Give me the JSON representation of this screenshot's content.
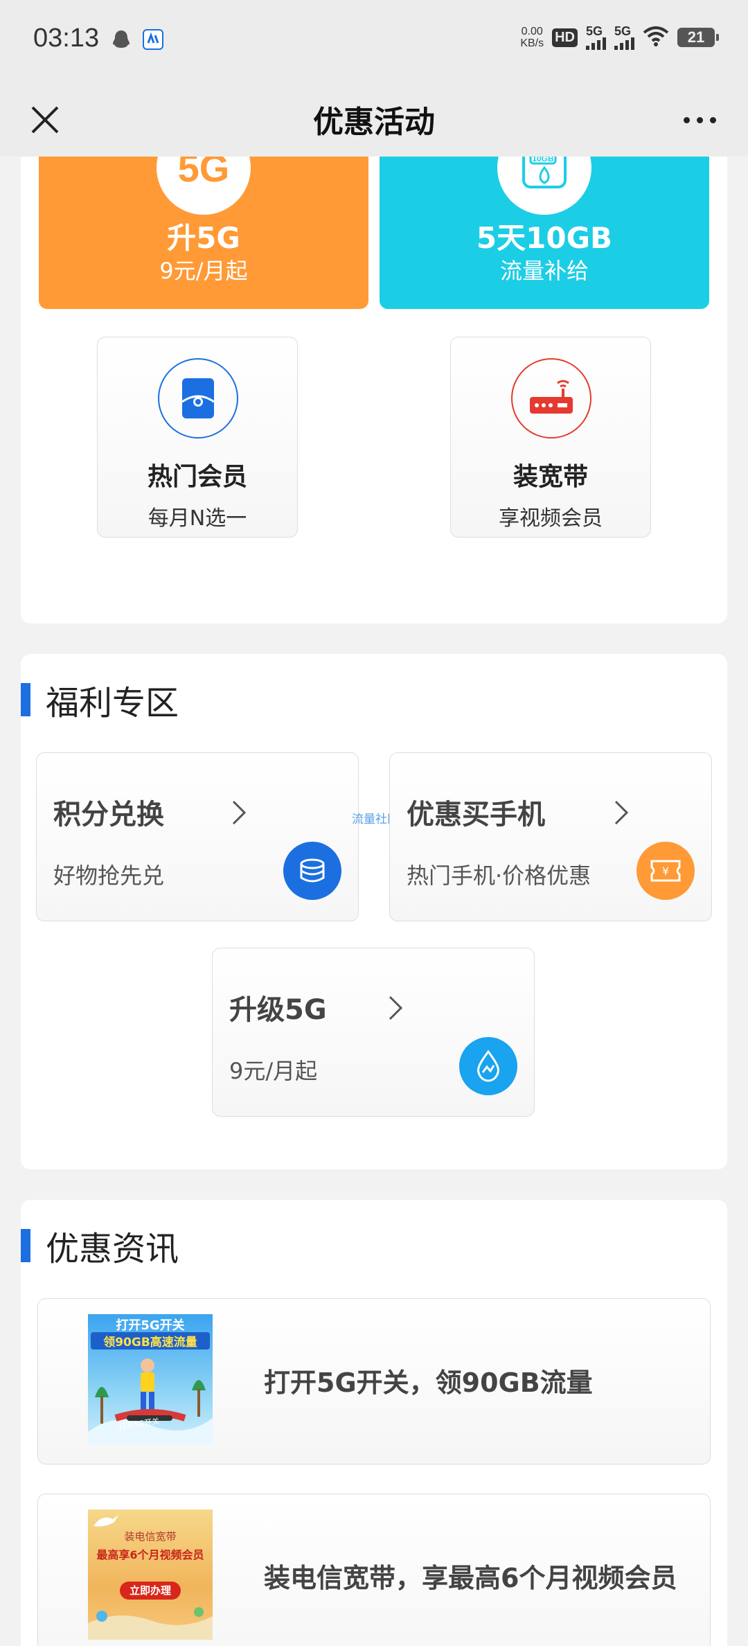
{
  "status_bar": {
    "time": "03:13",
    "net_speed_value": "0.00",
    "net_speed_unit": "KB/s",
    "hd_label": "HD",
    "sim1_label": "5G",
    "sim2_label": "5G",
    "battery": "21"
  },
  "nav": {
    "title": "优惠活动"
  },
  "top_section": {
    "tiles": [
      {
        "icon_text": "5G",
        "title": "升5G",
        "subtitle": "9元/月起",
        "color": "#ff9a36"
      },
      {
        "icon_text": "10GB",
        "title": "5天10GB",
        "subtitle": "流量补给",
        "color": "#1ccde6"
      }
    ],
    "small_tiles": [
      {
        "title": "热门会员",
        "subtitle": "每月N选一"
      },
      {
        "title": "装宽带",
        "subtitle": "享视频会员"
      }
    ]
  },
  "welfare": {
    "title": "福利专区",
    "items": [
      {
        "title": "积分兑换",
        "subtitle": "好物抢先兑"
      },
      {
        "title": "优惠买手机",
        "subtitle": "热门手机·价格优惠"
      },
      {
        "title": "升级5G",
        "subtitle": "9元/月起"
      }
    ],
    "watermark": "流量社区"
  },
  "news": {
    "title": "优惠资讯",
    "items": [
      {
        "title": "打开5G开关，领90GB流量",
        "thumb_line1": "打开5G开关",
        "thumb_line2": "领90GB高速流量",
        "thumb_line3": "打开5G开关"
      },
      {
        "title": "装电信宽带，享最高6个月视频会员",
        "thumb_line1": "装电信宽带",
        "thumb_line2": "最高享6个月视频会员",
        "thumb_line3": "立即办理"
      }
    ]
  },
  "colors": {
    "accent_blue": "#1b6fe0",
    "orange": "#ff9a36",
    "cyan": "#1ccde6",
    "red_icon": "#e53a2f"
  }
}
